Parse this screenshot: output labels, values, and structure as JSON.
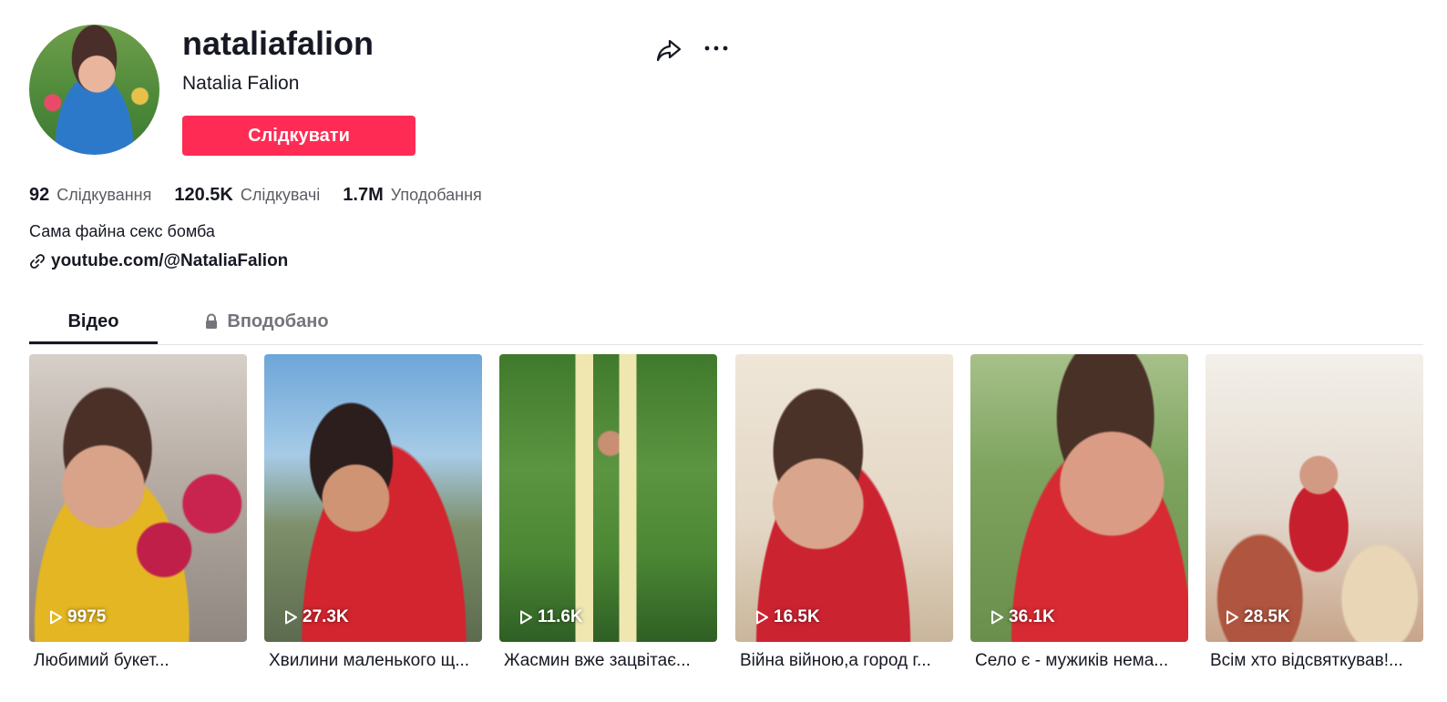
{
  "profile": {
    "username": "nataliafalion",
    "nickname": "Natalia Falion",
    "follow_label": "Слідкувати",
    "bio": "Сама файна секс бомба",
    "link": "youtube.com/@NataliaFalion"
  },
  "stats": [
    {
      "value": "92",
      "label": "Слідкування"
    },
    {
      "value": "120.5K",
      "label": "Слідкувачі"
    },
    {
      "value": "1.7M",
      "label": "Уподобання"
    }
  ],
  "tabs": [
    {
      "label": "Відео",
      "active": true
    },
    {
      "label": "Вподобано",
      "locked": true
    }
  ],
  "videos": [
    {
      "views": "9975",
      "caption": "Любимий букет..."
    },
    {
      "views": "27.3K",
      "caption": "Хвилини маленького щ..."
    },
    {
      "views": "11.6K",
      "caption": "Жасмин вже зацвітає..."
    },
    {
      "views": "16.5K",
      "caption": "Війна війною,а город г..."
    },
    {
      "views": "36.1K",
      "caption": "Село є - мужиків нема..."
    },
    {
      "views": "28.5K",
      "caption": "Всім хто відсвяткував!..."
    }
  ],
  "icons": {
    "share": "share-icon",
    "more": "more-icon",
    "link": "link-icon",
    "lock": "lock-icon",
    "play": "play-icon"
  },
  "colors": {
    "accent": "#fe2c55",
    "text": "#161823",
    "secondary_text": "#5b5c62"
  }
}
